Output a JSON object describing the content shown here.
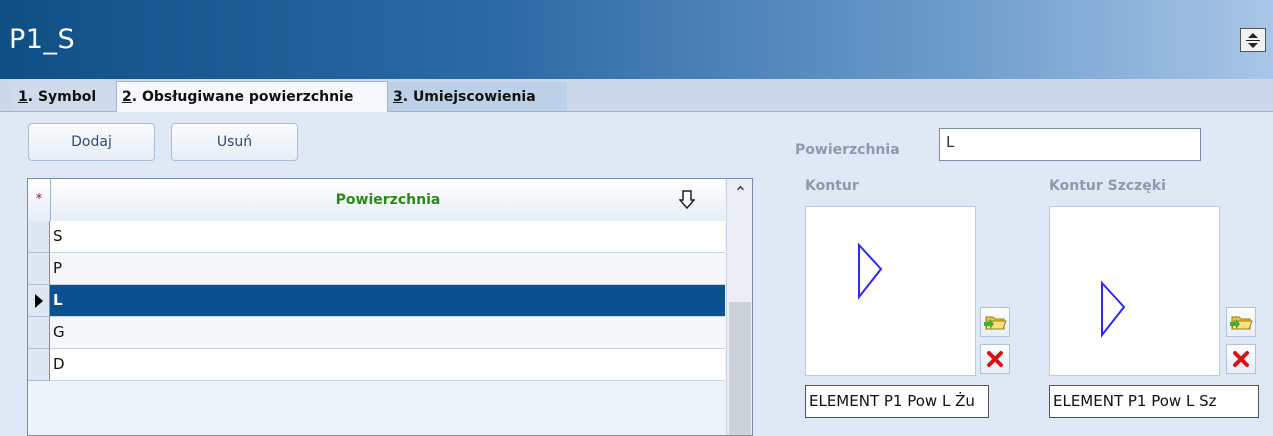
{
  "window": {
    "title": "P1_S"
  },
  "tabs": [
    {
      "key": "1",
      "label": ". Symbol"
    },
    {
      "key": "2",
      "label": ". Obsługiwane powierzchnie"
    },
    {
      "key": "3",
      "label": ". Umiejscowienia"
    }
  ],
  "toolbar": {
    "add_label": "Dodaj",
    "remove_label": "Usuń"
  },
  "grid": {
    "header_marker": "*",
    "column_header": "Powierzchnia",
    "rows": [
      "S",
      "P",
      "L",
      "G",
      "D"
    ],
    "selected_row": "L"
  },
  "detail": {
    "powierzchnia_label": "Powierzchnia",
    "powierzchnia_value": "L",
    "kontur_label": "Kontur",
    "kontur_file": "ELEMENT P1 Pow L Żu",
    "kontur_szczeki_label": "Kontur Szczęki",
    "kontur_szczeki_file": "ELEMENT P1 Pow L Sz"
  },
  "colors": {
    "accent": "#0b5191",
    "header_green": "#2a8a16",
    "shape_blue": "#2a2aff"
  },
  "icons": [
    "resize-icon",
    "sort-icon",
    "row-pointer-icon",
    "scroll-up-icon",
    "folder-open-icon",
    "delete-icon"
  ]
}
